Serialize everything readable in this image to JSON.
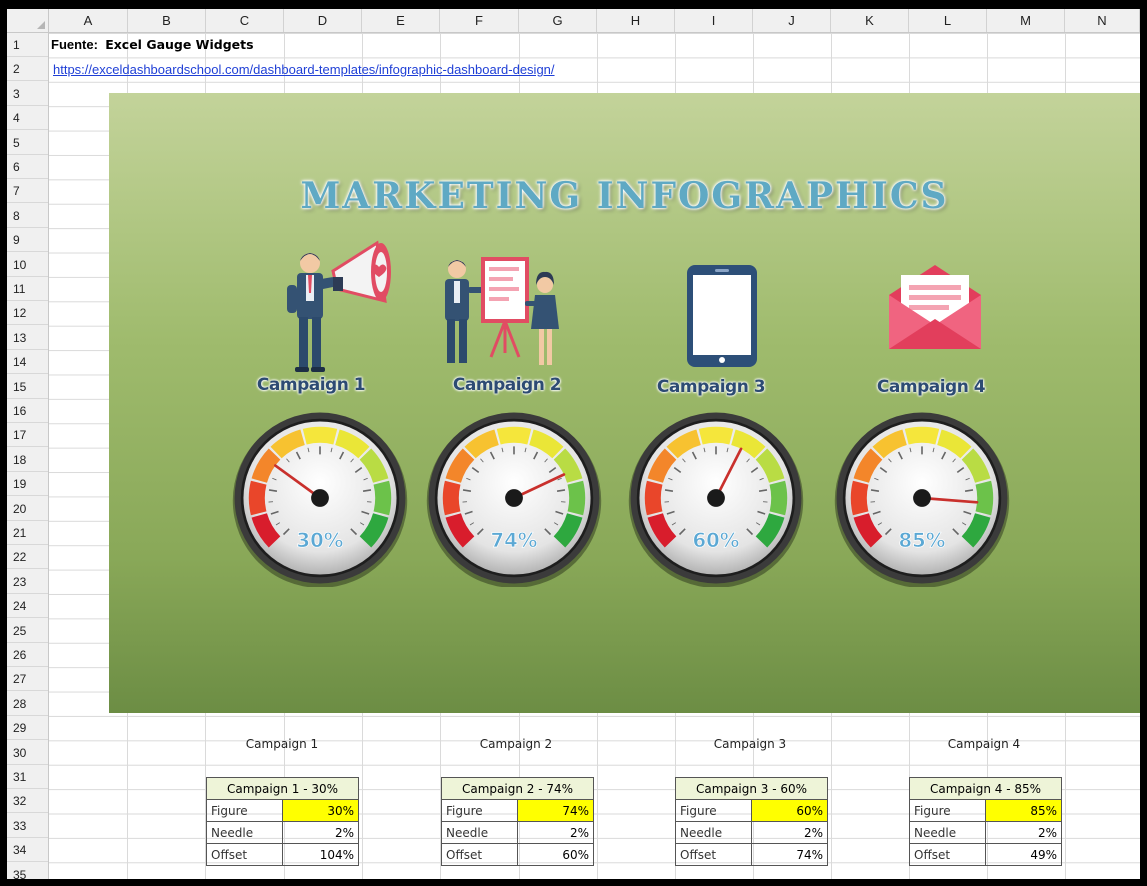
{
  "columns": [
    "A",
    "B",
    "C",
    "D",
    "E",
    "F",
    "G",
    "H",
    "I",
    "J",
    "K",
    "L",
    "M",
    "N"
  ],
  "rows": [
    "1",
    "2",
    "3",
    "4",
    "5",
    "6",
    "7",
    "8",
    "9",
    "10",
    "11",
    "12",
    "13",
    "14",
    "15",
    "16",
    "17",
    "18",
    "19",
    "20",
    "21",
    "22",
    "23",
    "24",
    "25",
    "26",
    "27",
    "28",
    "29",
    "30",
    "31",
    "32",
    "33",
    "34",
    "35"
  ],
  "a1": {
    "label": "Fuente:",
    "value": "Excel Gauge Widgets"
  },
  "a2": {
    "link": "https://exceldashboardschool.com/dashboard-templates/infographic-dashboard-design/"
  },
  "banner": {
    "title": "MARKETING INFOGRAPHICS"
  },
  "campaigns": [
    {
      "label": "Campaign 1",
      "gauge_text": "30%",
      "value": 0.3,
      "icon": "megaphone-man-icon"
    },
    {
      "label": "Campaign 2",
      "gauge_text": "74%",
      "value": 0.74,
      "icon": "presentation-people-icon"
    },
    {
      "label": "Campaign 3",
      "gauge_text": "60%",
      "value": 0.6,
      "icon": "tablet-icon"
    },
    {
      "label": "Campaign 4",
      "gauge_text": "85%",
      "value": 0.85,
      "icon": "envelope-icon"
    }
  ],
  "tables": [
    {
      "caption": "Campaign 1",
      "header": "Campaign 1 - 30%",
      "figure_label": "Figure",
      "figure": "30%",
      "needle_label": "Needle",
      "needle": "2%",
      "offset_label": "Offset",
      "offset": "104%"
    },
    {
      "caption": "Campaign 2",
      "header": "Campaign 2 - 74%",
      "figure_label": "Figure",
      "figure": "74%",
      "needle_label": "Needle",
      "needle": "2%",
      "offset_label": "Offset",
      "offset": "60%"
    },
    {
      "caption": "Campaign 3",
      "header": "Campaign 3 - 60%",
      "figure_label": "Figure",
      "figure": "60%",
      "needle_label": "Needle",
      "needle": "2%",
      "offset_label": "Offset",
      "offset": "74%"
    },
    {
      "caption": "Campaign 4",
      "header": "Campaign 4 - 85%",
      "figure_label": "Figure",
      "figure": "85%",
      "needle_label": "Needle",
      "needle": "2%",
      "offset_label": "Offset",
      "offset": "49%"
    }
  ],
  "colors": {
    "highlight": "#ffff00",
    "header_fill": "#eef4d8",
    "title": "#5fa9c4",
    "label": "#2d4b73"
  }
}
